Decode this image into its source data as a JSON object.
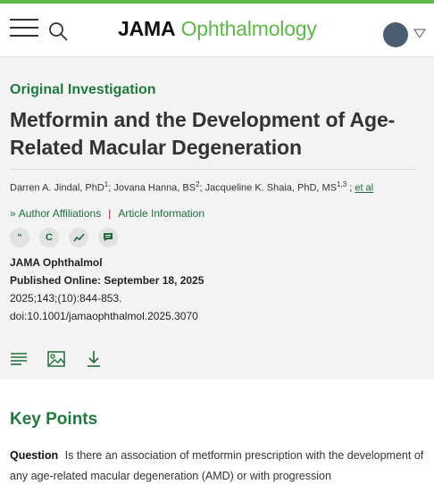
{
  "header": {
    "brand": "JAMA",
    "journal": "Ophthalmology",
    "accent_color": "#5cb946",
    "menu_icon": "hamburger-menu-icon",
    "search_icon": "search-icon",
    "avatar_icon": "user-avatar-icon",
    "caret_icon": "chevron-down-icon"
  },
  "article": {
    "section": "Original Investigation",
    "title": "Metformin and the Development of Age-Related Macular Degeneration",
    "authors": [
      {
        "name": "Darren A. Jindal, PhD",
        "sup": "1"
      },
      {
        "name": "Jovana Hanna, BS",
        "sup": "2"
      },
      {
        "name": "Jacqueline K. Shaia, PhD, MS",
        "sup": "1,3"
      }
    ],
    "et_al": "et al",
    "links": {
      "affiliations": "Author Affiliations",
      "separator": "|",
      "info": "Article Information"
    },
    "action_icons": [
      {
        "name": "cite-icon",
        "glyph": "“"
      },
      {
        "name": "copyright-icon",
        "glyph": "C"
      },
      {
        "name": "metrics-icon",
        "glyph": ""
      },
      {
        "name": "comment-icon",
        "glyph": ""
      }
    ],
    "journal_abbrev": "JAMA Ophthalmol",
    "published": "Published Online: September 18, 2025",
    "citation": "2025;143;(10):844-853.",
    "doi": "doi:10.1001/jamaophthalmol.2025.3070",
    "tool_icons": [
      "full-text-icon",
      "figures-icon",
      "download-icon"
    ]
  },
  "key_points": {
    "heading": "Key Points",
    "question_label": "Question",
    "question_text": "Is there an association of metformin prescription with the development of any age-related macular degeneration (AMD) or with progression"
  }
}
